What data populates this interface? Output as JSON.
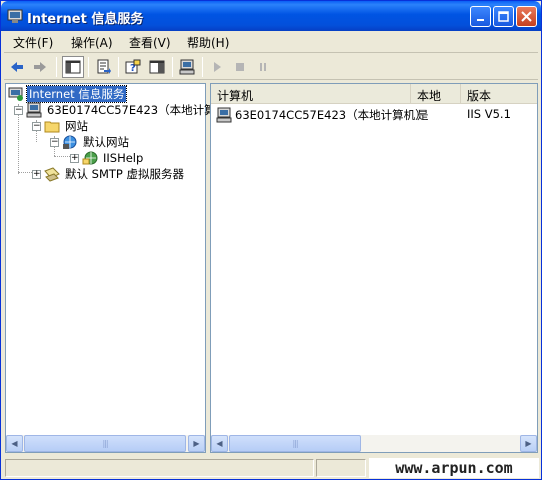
{
  "window": {
    "title": "Internet 信息服务"
  },
  "menu": [
    {
      "label": "文件(F)"
    },
    {
      "label": "操作(A)"
    },
    {
      "label": "查看(V)"
    },
    {
      "label": "帮助(H)"
    }
  ],
  "tree": {
    "root": "Internet 信息服务",
    "computer": "63E0174CC57E423（本地计算机）",
    "websites": "网站",
    "default_site": "默认网站",
    "iishelp": "IISHelp",
    "smtp": "默认 SMTP 虚拟服务器"
  },
  "list": {
    "columns": [
      "计算机",
      "本地",
      "版本"
    ],
    "rows": [
      {
        "computer": "63E0174CC57E423（本地计算机）",
        "local": "是",
        "version": "IIS V5.1"
      }
    ]
  },
  "status": {
    "watermark": "www.arpun.com"
  }
}
